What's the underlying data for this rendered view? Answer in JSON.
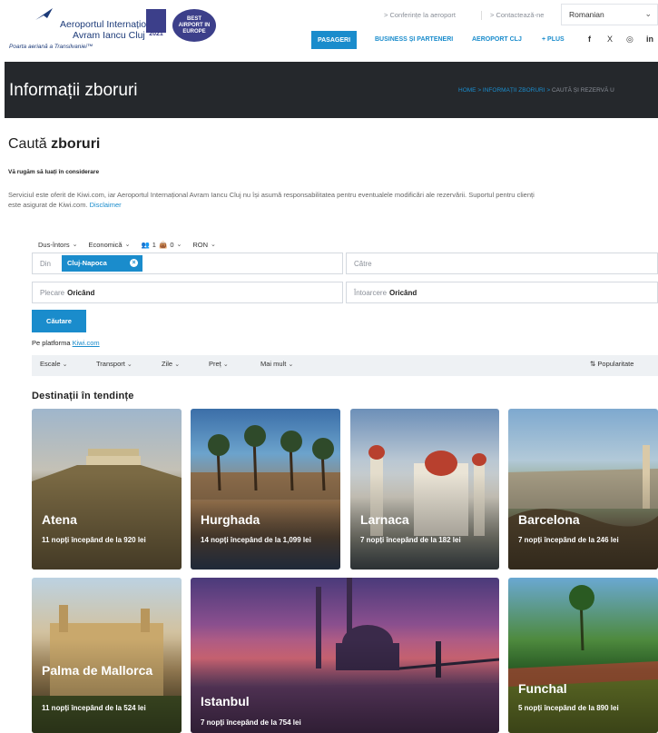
{
  "header": {
    "logo_title": "Aeroportul Internațional",
    "logo_subtitle": "Avram Iancu Cluj",
    "logo_tagline": "Poarta aeriană a Transilvaniei™",
    "award_year": "2021",
    "award_text": "BEST AIRPORT IN EUROPE",
    "top_links": [
      "> Conferințe la aeroport",
      "> Contactează-ne"
    ],
    "language": "Romanian",
    "nav": [
      "PASAGERI",
      "BUSINESS ȘI PARTENERI",
      "AEROPORT CLJ",
      "+ PLUS"
    ],
    "social": [
      "f",
      "X",
      "◎",
      "in"
    ],
    "accent_color": "#1a8ccc",
    "brand_color": "#1c3a78"
  },
  "banner": {
    "title": "Informații zboruri",
    "breadcrumb": [
      "HOME",
      ">",
      "INFORMAȚII ZBORURI",
      ">",
      "CAUTĂ ȘI REZERVĂ U"
    ]
  },
  "search": {
    "heading_prefix": "Caută",
    "heading_bold": "zboruri",
    "notice_title": "Vă rugăm să luați în considerare",
    "notice_line1": "Serviciul este oferit de Kiwi.com, iar Aeroportul Internațional Avram Iancu Cluj nu își asumă responsabilitatea pentru eventualele modificări ale rezervării. Suportul pentru clienți",
    "notice_line2": "este asigurat de Kiwi.com.",
    "disclaimer_link": "Disclaimer",
    "options": [
      "Dus-întors",
      "Economică",
      "1",
      "0",
      "RON"
    ],
    "from_label": "Din",
    "from_value": "Cluj-Napoca",
    "to_placeholder": "Către",
    "departure_label": "Plecare",
    "departure_value": "Oricând",
    "return_label": "Întoarcere",
    "return_value": "Oricând",
    "button": "Căutare",
    "platform_text": "Pe platforma",
    "platform_link": "Kiwi.com"
  },
  "filters": {
    "items": [
      "Escale",
      "Transport",
      "Zile",
      "Preț",
      "Mai mult"
    ],
    "sort": "Popularitate"
  },
  "trending": {
    "title": "Destinații în tendințe",
    "cards": [
      {
        "city": "Atena",
        "offer": "11 nopți începând de la 920 lei"
      },
      {
        "city": "Hurghada",
        "offer": "14 nopți începând de la 1,099 lei"
      },
      {
        "city": "Larnaca",
        "offer": "7 nopți începând de la 182 lei"
      },
      {
        "city": "Barcelona",
        "offer": "7 nopți începând de la 246 lei"
      },
      {
        "city": "Palma de Mallorca",
        "offer": "11 nopți începând de la 524 lei"
      },
      {
        "city": "Istanbul",
        "offer": "7 nopți începând de la 754 lei"
      },
      {
        "city": "Funchal",
        "offer": "5 nopți începând de la 890 lei"
      }
    ]
  }
}
